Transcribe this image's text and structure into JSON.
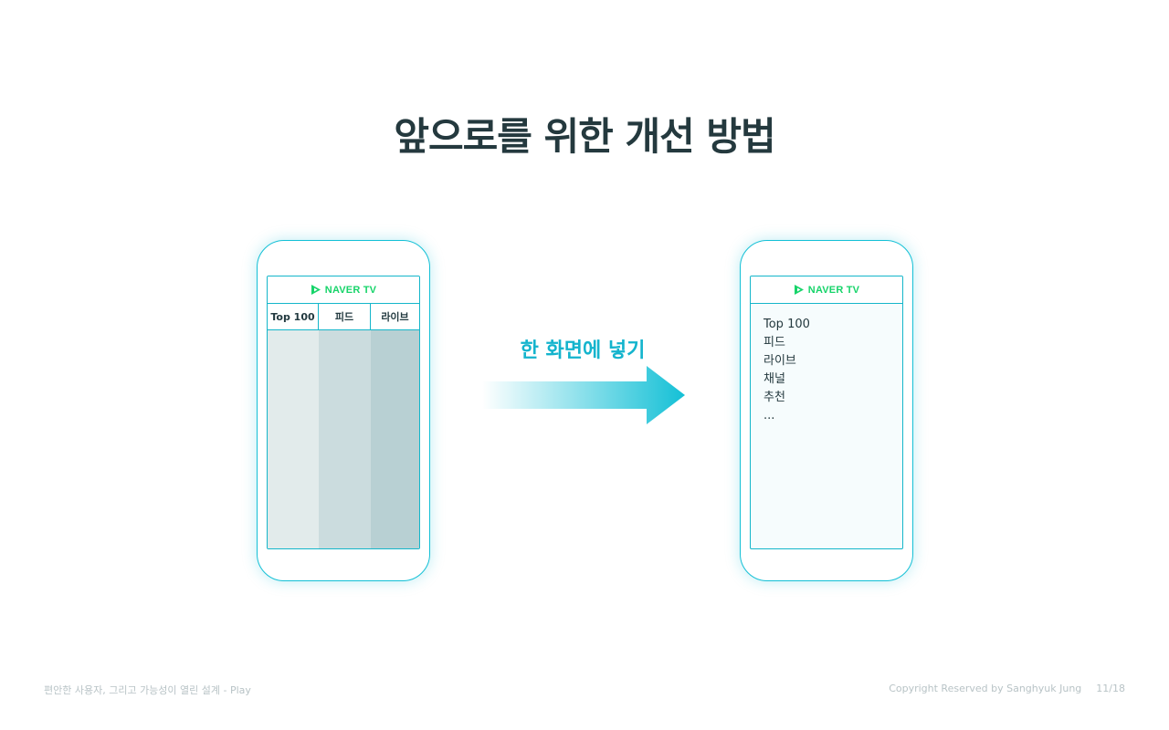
{
  "title": "앞으로를 위한 개선 방법",
  "left_phone": {
    "logo_text": "NAVER TV",
    "tabs": [
      "Top 100",
      "피드",
      "라이브"
    ]
  },
  "arrow_label": "한 화면에 넣기",
  "right_phone": {
    "logo_text": "NAVER TV",
    "menu": [
      "Top 100",
      "피드",
      "라이브",
      "채널",
      "추천",
      "..."
    ]
  },
  "footer": {
    "left": "편안한 사용자, 그리고 가능성이 열린 설계 - Play",
    "copyright": "Copyright Reserved by Sanghyuk Jung",
    "page": "11/18"
  },
  "colors": {
    "accent": "#14c0d6",
    "logo_green": "#17d46a",
    "title": "#24393e"
  }
}
